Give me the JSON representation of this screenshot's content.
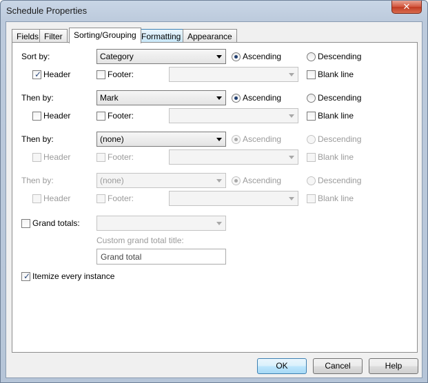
{
  "window": {
    "title": "Schedule Properties",
    "close_glyph": "✕"
  },
  "tabs": [
    "Fields",
    "Filter",
    "Sorting/Grouping",
    "Formatting",
    "Appearance"
  ],
  "sort_rows": [
    {
      "label": "Sort by:",
      "value": "Category",
      "ascending": "Ascending",
      "descending": "Descending",
      "header": "Header",
      "footer": "Footer:",
      "blank_line": "Blank line",
      "header_checked": true
    },
    {
      "label": "Then by:",
      "value": "Mark",
      "ascending": "Ascending",
      "descending": "Descending",
      "header": "Header",
      "footer": "Footer:",
      "blank_line": "Blank line",
      "header_checked": false
    },
    {
      "label": "Then by:",
      "value": "(none)",
      "ascending": "Ascending",
      "descending": "Descending",
      "header": "Header",
      "footer": "Footer:",
      "blank_line": "Blank line",
      "header_checked": false
    },
    {
      "label": "Then by:",
      "value": "(none)",
      "ascending": "Ascending",
      "descending": "Descending",
      "header": "Header",
      "footer": "Footer:",
      "blank_line": "Blank line",
      "header_checked": false
    }
  ],
  "grand_totals": {
    "label": "Grand totals:",
    "value": "",
    "custom_title_label": "Custom grand total title:",
    "custom_title_value": "Grand total"
  },
  "itemize": {
    "label": "Itemize every instance",
    "checked": true
  },
  "buttons": {
    "ok": "OK",
    "cancel": "Cancel",
    "help": "Help"
  },
  "colors": {
    "accent": "#3c7fb1",
    "check": "#2c4a7d",
    "disabled_text": "#9a9a9a"
  }
}
